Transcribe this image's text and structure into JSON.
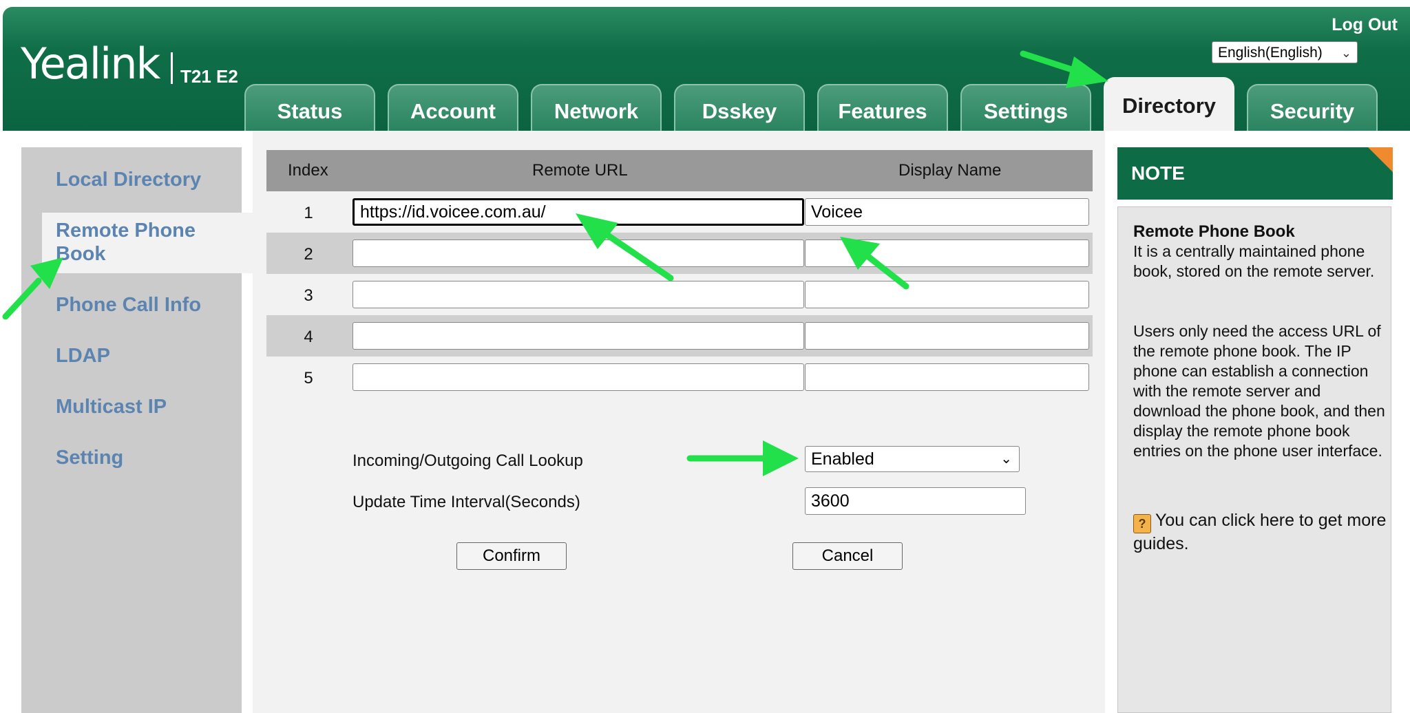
{
  "header": {
    "brand": "Yealink",
    "model": "T21 E2",
    "logout": "Log Out",
    "language": "English(English)"
  },
  "tabs": [
    {
      "label": "Status"
    },
    {
      "label": "Account"
    },
    {
      "label": "Network"
    },
    {
      "label": "Dsskey"
    },
    {
      "label": "Features"
    },
    {
      "label": "Settings"
    },
    {
      "label": "Directory",
      "active": true
    },
    {
      "label": "Security"
    }
  ],
  "sidebar": {
    "items": [
      {
        "label": "Local Directory"
      },
      {
        "label": "Remote Phone Book",
        "active": true
      },
      {
        "label": "Phone Call Info"
      },
      {
        "label": "LDAP"
      },
      {
        "label": "Multicast IP"
      },
      {
        "label": "Setting"
      }
    ]
  },
  "table": {
    "headers": {
      "index": "Index",
      "url": "Remote URL",
      "name": "Display Name"
    },
    "rows": [
      {
        "index": "1",
        "url": "https://id.voicee.com.au/",
        "name": "Voicee"
      },
      {
        "index": "2",
        "url": "",
        "name": ""
      },
      {
        "index": "3",
        "url": "",
        "name": ""
      },
      {
        "index": "4",
        "url": "",
        "name": ""
      },
      {
        "index": "5",
        "url": "",
        "name": ""
      }
    ]
  },
  "settings": {
    "lookup_label": "Incoming/Outgoing Call Lookup",
    "lookup_value": "Enabled",
    "interval_label": "Update Time Interval(Seconds)",
    "interval_value": "3600"
  },
  "buttons": {
    "confirm": "Confirm",
    "cancel": "Cancel"
  },
  "note": {
    "heading": "NOTE",
    "title": "Remote Phone Book",
    "p1": "It is a centrally maintained phone book, stored on the remote server.",
    "p2": "Users only need the access URL of the remote phone book. The IP phone can establish a connection with the remote server and download the phone book, and then display the remote phone book entries on the phone user interface.",
    "guide": "You can click here to get more guides."
  },
  "colors": {
    "header_green": "#0f6e47",
    "nav_link": "#5c84b0",
    "annotation_arrow": "#22e04a",
    "note_corner": "#f08a2e"
  }
}
